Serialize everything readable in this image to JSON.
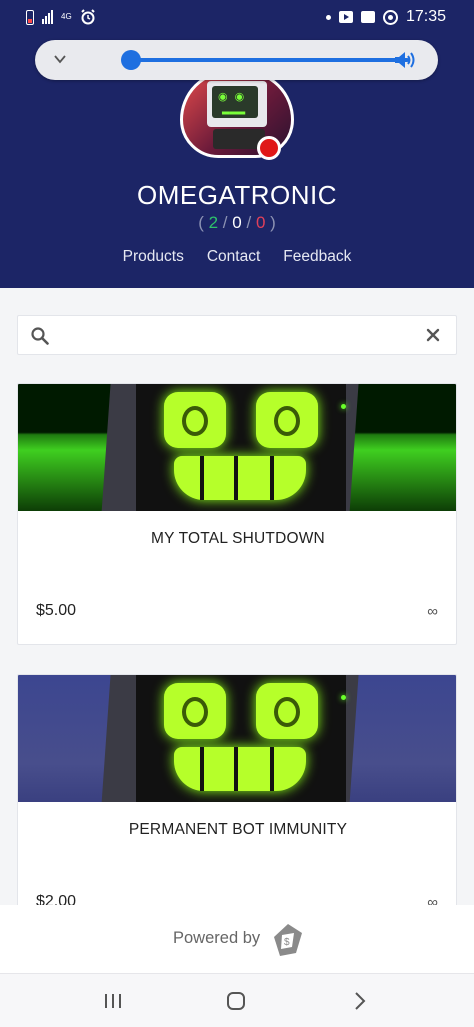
{
  "status_bar": {
    "network": "4G",
    "time": "17:35"
  },
  "volume": {
    "level": 0.0
  },
  "store": {
    "name": "OMEGATRONIC",
    "ratings": {
      "open": "(",
      "positive": "2",
      "sep1": "/",
      "neutral": "0",
      "sep2": "/",
      "negative": "0",
      "close": ")"
    }
  },
  "nav": {
    "items": [
      {
        "label": "Products"
      },
      {
        "label": "Contact"
      },
      {
        "label": "Feedback"
      }
    ]
  },
  "search": {
    "value": "",
    "placeholder": ""
  },
  "products": [
    {
      "title": "MY TOTAL SHUTDOWN",
      "price": "$5.00",
      "stock": "∞"
    },
    {
      "title": "PERMANENT BOT IMMUNITY",
      "price": "$2.00",
      "stock": "∞"
    }
  ],
  "footer": {
    "powered_by": "Powered by"
  },
  "icons": {
    "chevron": "chevron-down-icon",
    "speaker": "volume-icon",
    "search": "search-icon",
    "clear": "close-icon",
    "logo": "sellix-logo-icon"
  },
  "colors": {
    "header_bg": "#1c2566",
    "accent": "#1e6fe0",
    "positive": "#2ec26a",
    "negative": "#e0405a"
  }
}
